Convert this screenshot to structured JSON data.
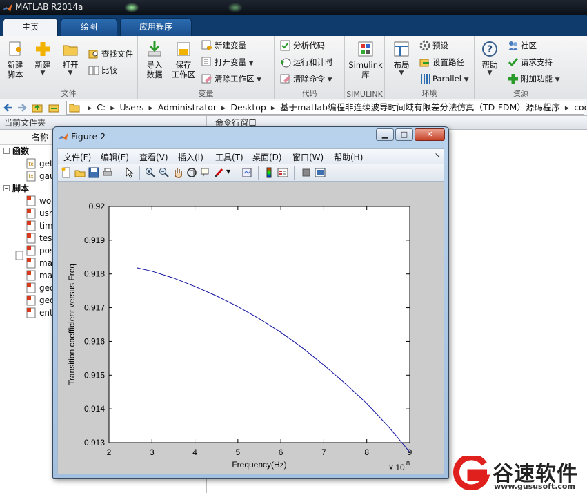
{
  "app": {
    "title": "MATLAB R2014a"
  },
  "ribbon": {
    "tabs": [
      "主页",
      "绘图",
      "应用程序"
    ],
    "groups": {
      "file": {
        "label": "文件",
        "new_script": "新建\n脚本",
        "new": "新建",
        "open": "打开",
        "find_files": "查找文件",
        "compare": "比较"
      },
      "variable": {
        "label": "变量",
        "import": "导入\n数据",
        "save_ws": "保存\n工作区",
        "new_var": "新建变量",
        "open_var": "打开变量",
        "clear_ws": "清除工作区"
      },
      "code": {
        "label": "代码",
        "analyze": "分析代码",
        "run_time": "运行和计时",
        "clear_cmd": "清除命令"
      },
      "simulink": {
        "label": "SIMULINK",
        "lib": "Simulink\n库"
      },
      "env": {
        "label": "环境",
        "layout": "布局",
        "prefs": "预设",
        "set_path": "设置路径",
        "parallel": "Parallel"
      },
      "resources": {
        "label": "资源",
        "help": "帮助",
        "community": "社区",
        "support": "请求支持",
        "addons": "附加功能"
      }
    }
  },
  "address": {
    "segments": [
      "C:",
      "Users",
      "Administrator",
      "Desktop",
      "基于matlab编程非连续波导时间域有限差分法仿真（TD-FDM）源码程序",
      "code"
    ]
  },
  "left_panel": {
    "title": "当前文件夹",
    "col_name": "名称",
    "sections": [
      {
        "name": "函数",
        "files": [
          "get",
          "gau"
        ]
      },
      {
        "name": "脚本",
        "files": [
          "wo",
          "usr",
          "tim",
          "tes",
          "pos",
          "ma",
          "ma",
          "geo",
          "geo",
          "ent"
        ]
      }
    ]
  },
  "command_window": {
    "title": "命令行窗口"
  },
  "figure": {
    "title": "Figure 2",
    "menu": [
      "文件(F)",
      "编辑(E)",
      "查看(V)",
      "插入(I)",
      "工具(T)",
      "桌面(D)",
      "窗口(W)",
      "帮助(H)"
    ]
  },
  "chart_data": {
    "type": "line",
    "title": "",
    "xlabel": "Frequency(Hz)",
    "ylabel": "Transition coefficient versus Freq",
    "x_multiplier": "x 10",
    "x_exponent": "8",
    "xlim": [
      2,
      9
    ],
    "ylim": [
      0.913,
      0.92
    ],
    "xticks": [
      "2",
      "3",
      "4",
      "5",
      "6",
      "7",
      "8",
      "9"
    ],
    "yticks": [
      "0.913",
      "0.914",
      "0.915",
      "0.916",
      "0.917",
      "0.918",
      "0.919",
      "0.92"
    ],
    "series": [
      {
        "color": "#1010a0",
        "x": [
          2.65,
          3.0,
          3.5,
          4.0,
          4.5,
          5.0,
          5.5,
          6.0,
          6.5,
          7.0,
          7.5,
          8.0,
          8.5,
          9.0
        ],
        "y": [
          0.91818,
          0.91808,
          0.91788,
          0.91763,
          0.91735,
          0.91703,
          0.91667,
          0.91627,
          0.91581,
          0.9153,
          0.91475,
          0.91416,
          0.91348,
          0.91272
        ]
      }
    ]
  },
  "watermark": {
    "text": "谷速软件",
    "url": "www.gususoft.com"
  }
}
